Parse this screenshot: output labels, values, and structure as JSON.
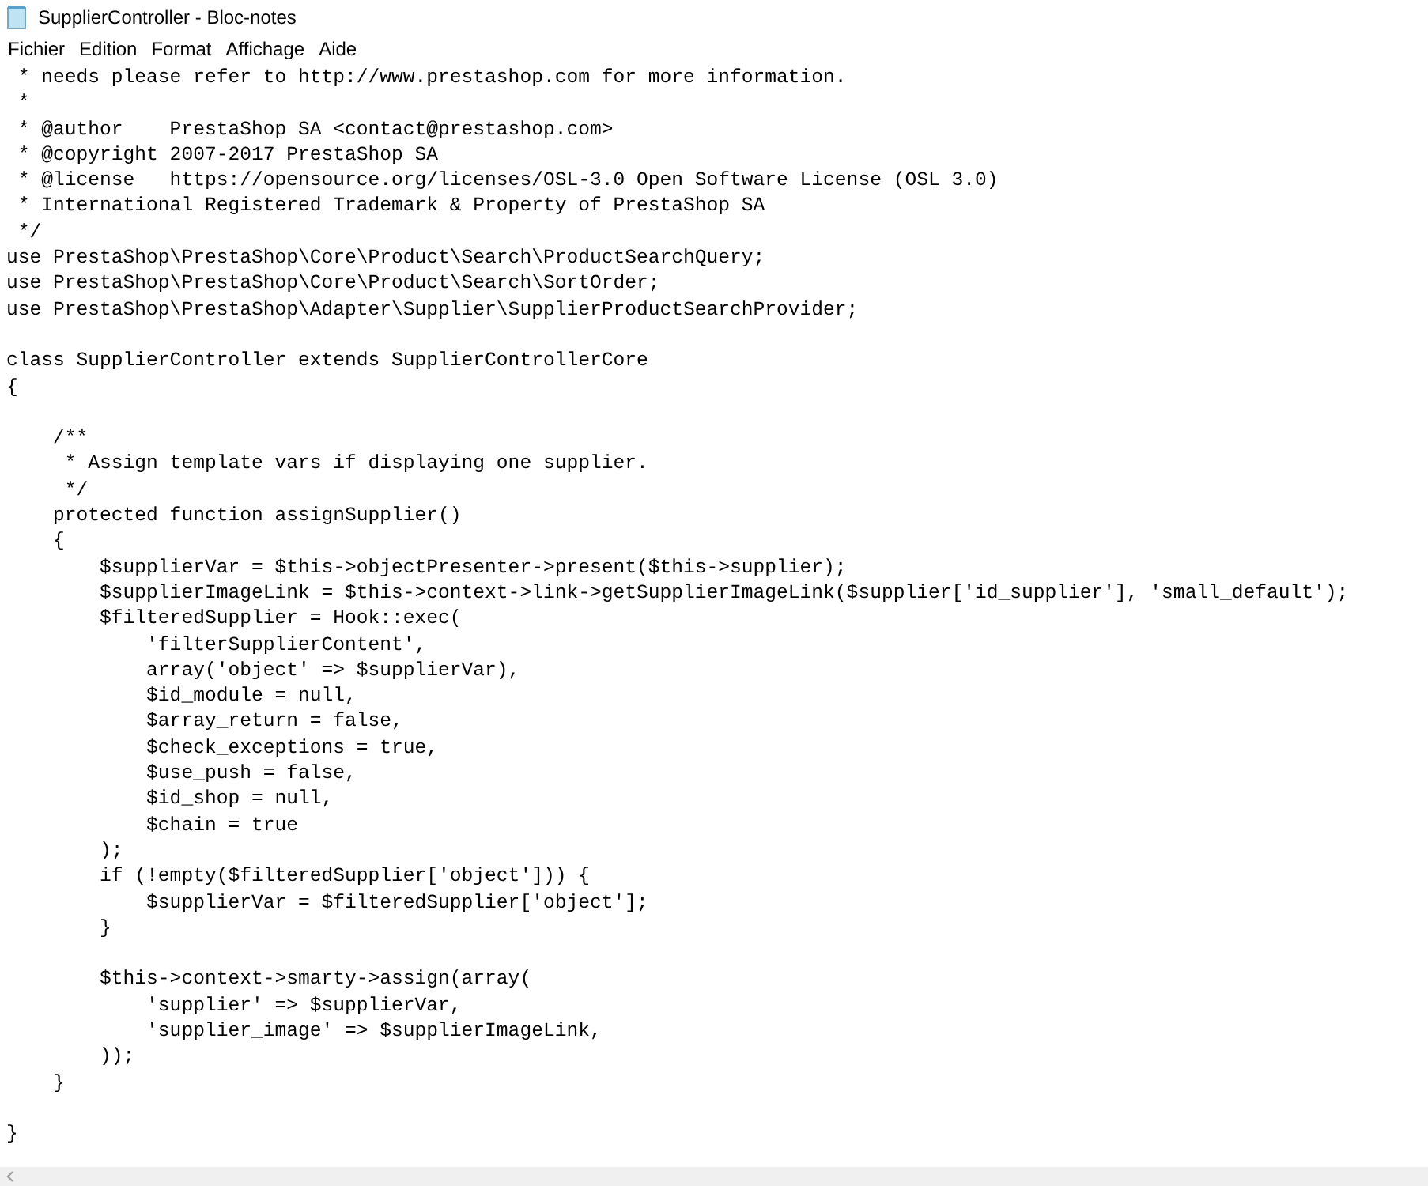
{
  "window": {
    "title": "SupplierController - Bloc-notes"
  },
  "menu": [
    "Fichier",
    "Edition",
    "Format",
    "Affichage",
    "Aide"
  ],
  "editor": {
    "blocks": [
      [
        " * needs please refer to http://www.prestashop.com for more information.",
        " *",
        " * @author    PrestaShop SA <contact@prestashop.com>",
        " * @copyright 2007-2017 PrestaShop SA",
        " * @license   https://opensource.org/licenses/OSL-3.0 Open Software License (OSL 3.0)",
        " * International Registered Trademark & Property of PrestaShop SA",
        " */",
        "use PrestaShop\\PrestaShop\\Core\\Product\\Search\\ProductSearchQuery;",
        "use PrestaShop\\PrestaShop\\Core\\Product\\Search\\SortOrder;",
        "use PrestaShop\\PrestaShop\\Adapter\\Supplier\\SupplierProductSearchProvider;"
      ],
      [
        "class SupplierController extends SupplierControllerCore",
        "{"
      ],
      [
        "    /**",
        "     * Assign template vars if displaying one supplier.",
        "     */",
        "    protected function assignSupplier()",
        "    {",
        "        $supplierVar = $this->objectPresenter->present($this->supplier);",
        "        $supplierImageLink = $this->context->link->getSupplierImageLink($supplier['id_supplier'], 'small_default');",
        "        $filteredSupplier = Hook::exec(",
        "            'filterSupplierContent',",
        "            array('object' => $supplierVar),",
        "            $id_module = null,",
        "            $array_return = false,",
        "            $check_exceptions = true,",
        "            $use_push = false,",
        "            $id_shop = null,",
        "            $chain = true",
        "        );",
        "        if (!empty($filteredSupplier['object'])) {",
        "            $supplierVar = $filteredSupplier['object'];",
        "        }"
      ],
      [
        "        $this->context->smarty->assign(array(",
        "            'supplier' => $supplierVar,",
        "            'supplier_image' => $supplierImageLink,",
        "        ));",
        "    }"
      ],
      [
        "}"
      ]
    ]
  }
}
